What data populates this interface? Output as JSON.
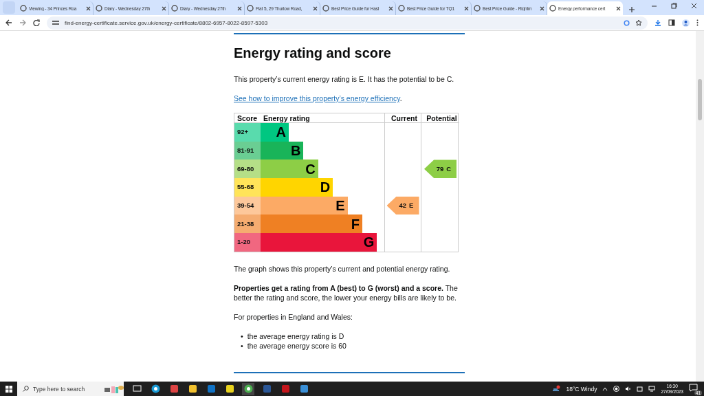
{
  "browser": {
    "tabs": [
      {
        "title": "Viewing - 34 Princes Roa",
        "selected": false
      },
      {
        "title": "Diary - Wednesday 27th",
        "selected": false
      },
      {
        "title": "Diary - Wednesday 27th",
        "selected": false
      },
      {
        "title": "Flat 5, 29 Thurlow Road,",
        "selected": false
      },
      {
        "title": "Best Price Guide for Hasl",
        "selected": false
      },
      {
        "title": "Best Price Guide for TQ1",
        "selected": false
      },
      {
        "title": "Best Price Guide - Rightm",
        "selected": false
      },
      {
        "title": "Energy performance cert",
        "selected": true
      }
    ],
    "address": "find-energy-certificate.service.gov.uk/energy-certificate/8802-6957-8022-8597-5303"
  },
  "page": {
    "heading": "Energy rating and score",
    "intro": "This property’s current energy rating is E. It has the potential to be C.",
    "link": "See how to improve this property’s energy efficiency",
    "link_suffix": ".",
    "rating_graph": {
      "headers": [
        "Score",
        "Energy rating",
        "Current",
        "Potential"
      ],
      "bands": [
        {
          "score": "92+",
          "letter": "A",
          "color": "#00c781"
        },
        {
          "score": "81-91",
          "letter": "B",
          "color": "#19b459"
        },
        {
          "score": "69-80",
          "letter": "C",
          "color": "#8dce46",
          "potential": {
            "score": "79",
            "letter": "C"
          }
        },
        {
          "score": "55-68",
          "letter": "D",
          "color": "#ffd500"
        },
        {
          "score": "39-54",
          "letter": "E",
          "color": "#fcaa65",
          "current": {
            "score": "42",
            "letter": "E"
          }
        },
        {
          "score": "21-38",
          "letter": "F",
          "color": "#ef8023"
        },
        {
          "score": "1-20",
          "letter": "G",
          "color": "#e9153b"
        }
      ]
    },
    "graph_note": "The graph shows this property’s current and potential energy rating.",
    "explanation": "**Properties get a rating from A (best) to G (worst) and a score.** The better the rating and score, the lower your energy bills are likely to be.",
    "averages_intro": "For properties in England and Wales:",
    "averages": [
      {
        "bullet": "•",
        "text": "the average energy rating is D"
      },
      {
        "bullet": "•",
        "text": "the average energy score is 60"
      }
    ]
  },
  "taskbar": {
    "search_placeholder": "Type here to search",
    "weather": "18°C  Windy",
    "time": "16:30",
    "date": "27/09/2023",
    "notifications": "41"
  }
}
